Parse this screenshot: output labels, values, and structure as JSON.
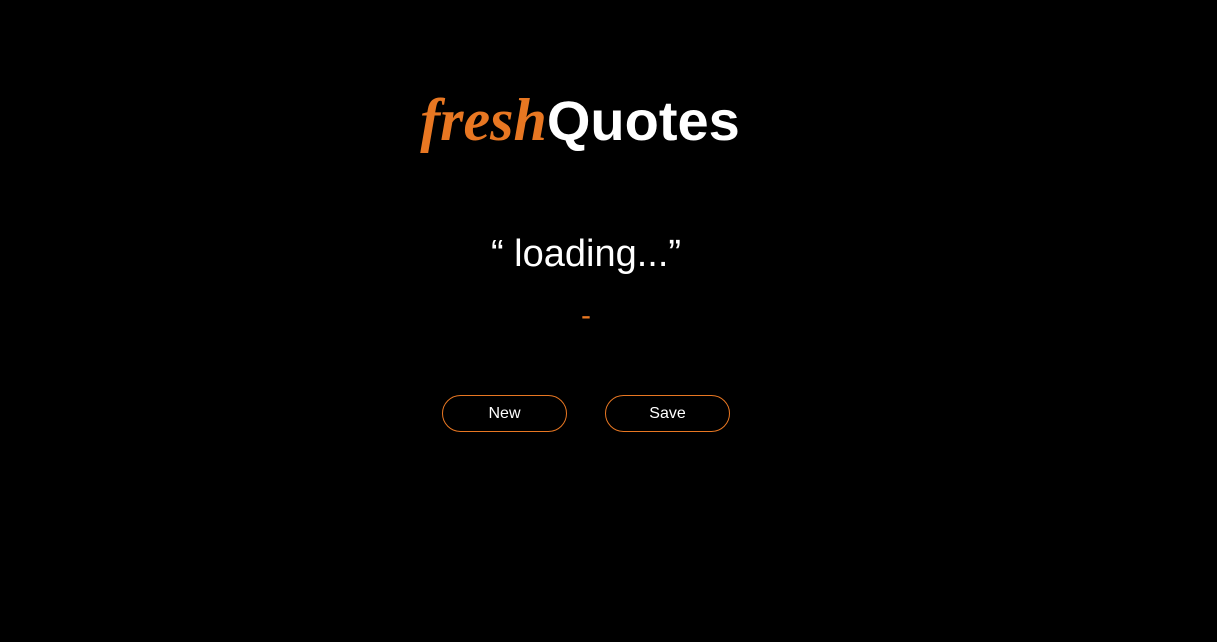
{
  "logo": {
    "prefix": "fresh",
    "suffix": "Quotes"
  },
  "quote": {
    "text": "“ loading...”"
  },
  "author": {
    "text": "-"
  },
  "actions": {
    "new_label": "New",
    "save_label": "Save"
  },
  "colors": {
    "accent": "#e87722",
    "background": "#000000",
    "text": "#ffffff"
  }
}
